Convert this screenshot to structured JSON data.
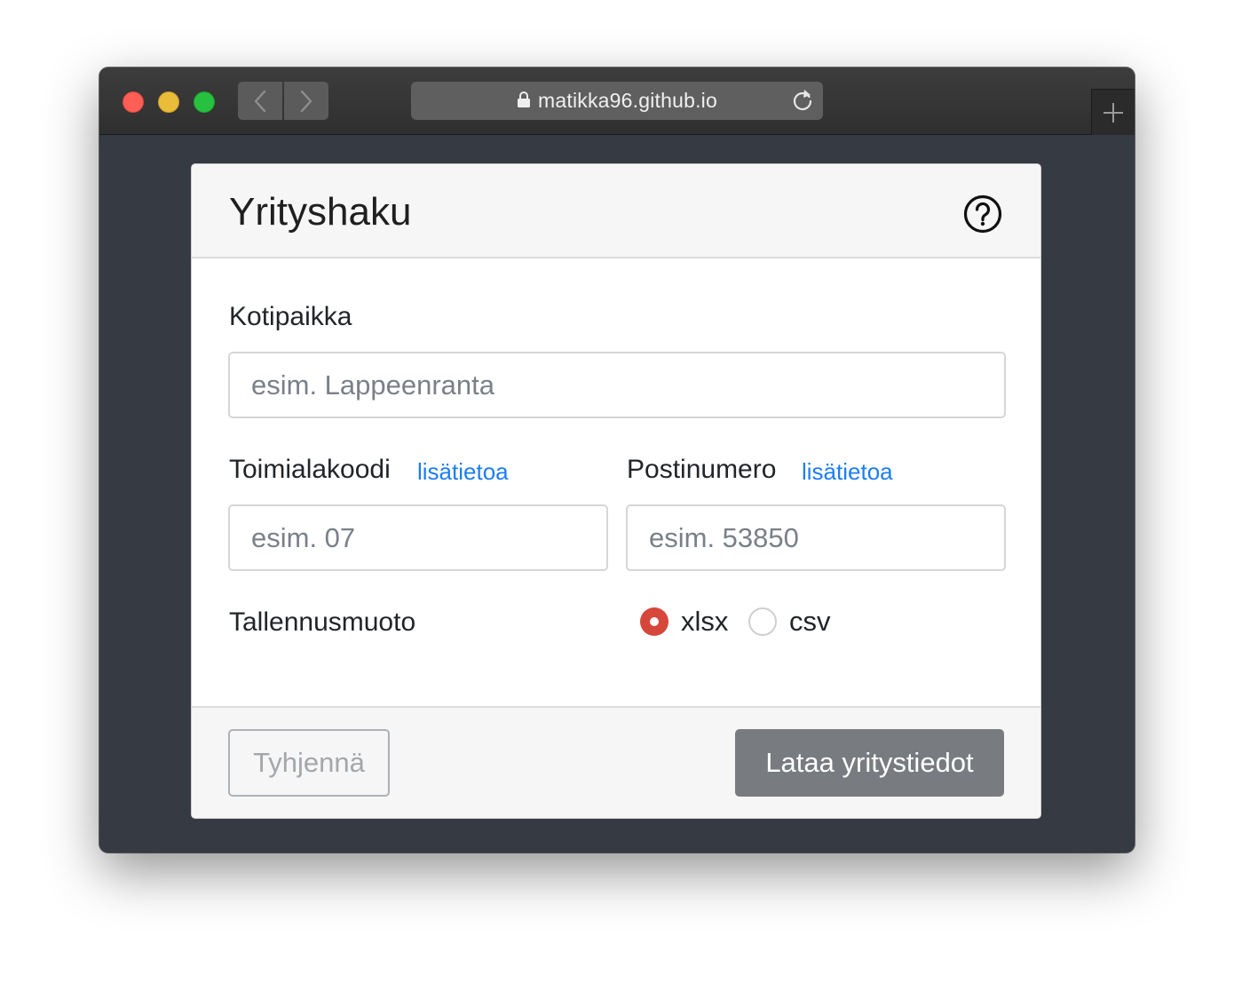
{
  "browser": {
    "url": "matikka96.github.io",
    "icons": {
      "back": "chevron-left-icon",
      "forward": "chevron-right-icon",
      "lock": "lock-icon",
      "reload": "reload-icon",
      "new_tab": "plus-icon"
    },
    "traffic_light_colors": [
      "#fd5f57",
      "#e9bc3a",
      "#28c13f"
    ]
  },
  "form": {
    "title": "Yrityshaku",
    "help_icon": "question-circle-icon",
    "kotipaikka": {
      "label": "Kotipaikka",
      "placeholder": "esim. Lappeenranta",
      "value": ""
    },
    "toimialakoodi": {
      "label": "Toimialakoodi",
      "link": "lisätietoa",
      "placeholder": "esim. 07",
      "value": ""
    },
    "postinumero": {
      "label": "Postinumero",
      "link": "lisätietoa",
      "placeholder": "esim. 53850",
      "value": ""
    },
    "format": {
      "label": "Tallennusmuoto",
      "options": [
        {
          "label": "xlsx",
          "selected": true
        },
        {
          "label": "csv",
          "selected": false
        }
      ]
    },
    "buttons": {
      "clear": "Tyhjennä",
      "download": "Lataa yritystiedot"
    }
  },
  "colors": {
    "accent_radio": "#d7463a",
    "link": "#1d7df2",
    "primary_button": "#787b80",
    "page_background": "#363a42"
  }
}
